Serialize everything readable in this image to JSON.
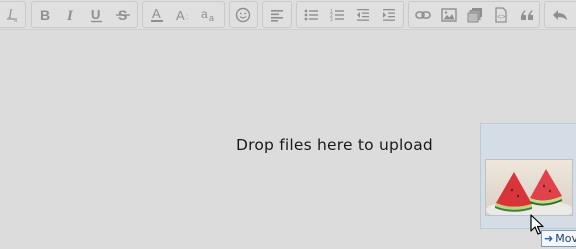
{
  "toolbar": {
    "groups": [
      {
        "name": "format-group",
        "buttons": [
          "clear-format-icon"
        ]
      },
      {
        "name": "text-style-group",
        "buttons": [
          "bold-icon",
          "italic-icon",
          "underline-icon",
          "strikethrough-icon"
        ]
      },
      {
        "name": "font-group",
        "buttons": [
          "text-color-icon",
          "font-size-icon",
          "font-family-icon"
        ]
      },
      {
        "name": "emoji-group",
        "buttons": [
          "smiley-icon"
        ]
      },
      {
        "name": "align-group",
        "buttons": [
          "align-left-icon"
        ]
      },
      {
        "name": "list-group",
        "buttons": [
          "bulleted-list-icon",
          "numbered-list-icon",
          "outdent-icon",
          "indent-icon"
        ]
      },
      {
        "name": "insert-group",
        "buttons": [
          "link-icon",
          "image-icon",
          "media-icon",
          "code-icon",
          "quote-icon"
        ]
      },
      {
        "name": "history-group",
        "buttons": [
          "undo-icon"
        ]
      }
    ],
    "icon_color": "#8f8f8f"
  },
  "editor": {
    "drop_message": "Drop files here to upload",
    "background": "#dcdcdc"
  },
  "drag_preview": {
    "image_subject": "watermelon slices",
    "tooltip_text": "Move"
  }
}
